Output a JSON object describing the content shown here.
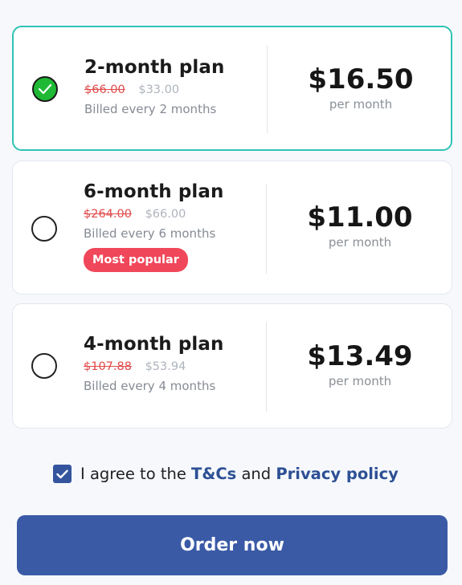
{
  "plans": [
    {
      "title": "2-month plan",
      "old_price": "$66.00",
      "new_price": "$33.00",
      "billed": "Billed every 2 months",
      "price": "$16.50",
      "per": "per month",
      "selected": true
    },
    {
      "title": "6-month plan",
      "old_price": "$264.00",
      "new_price": "$66.00",
      "billed": "Billed every 6 months",
      "badge": "Most popular",
      "price": "$11.00",
      "per": "per month",
      "selected": false
    },
    {
      "title": "4-month plan",
      "old_price": "$107.88",
      "new_price": "$53.94",
      "billed": "Billed every 4 months",
      "price": "$13.49",
      "per": "per month",
      "selected": false
    }
  ],
  "agreement": {
    "checked": true,
    "prefix": "I agree to the",
    "terms_link": "T&Cs",
    "and": "and",
    "privacy_link": "Privacy policy"
  },
  "order_button": "Order now",
  "colors": {
    "selected_border": "#2ec4b6",
    "check_green": "#1fb935",
    "badge_red": "#f0475a",
    "strike_red": "#e04b4b",
    "primary_blue": "#3a5aa6",
    "link_blue": "#2d4f94"
  },
  "icons": {
    "selected_radio": "check-icon",
    "agree_checkbox": "checkbox-checked-icon"
  }
}
